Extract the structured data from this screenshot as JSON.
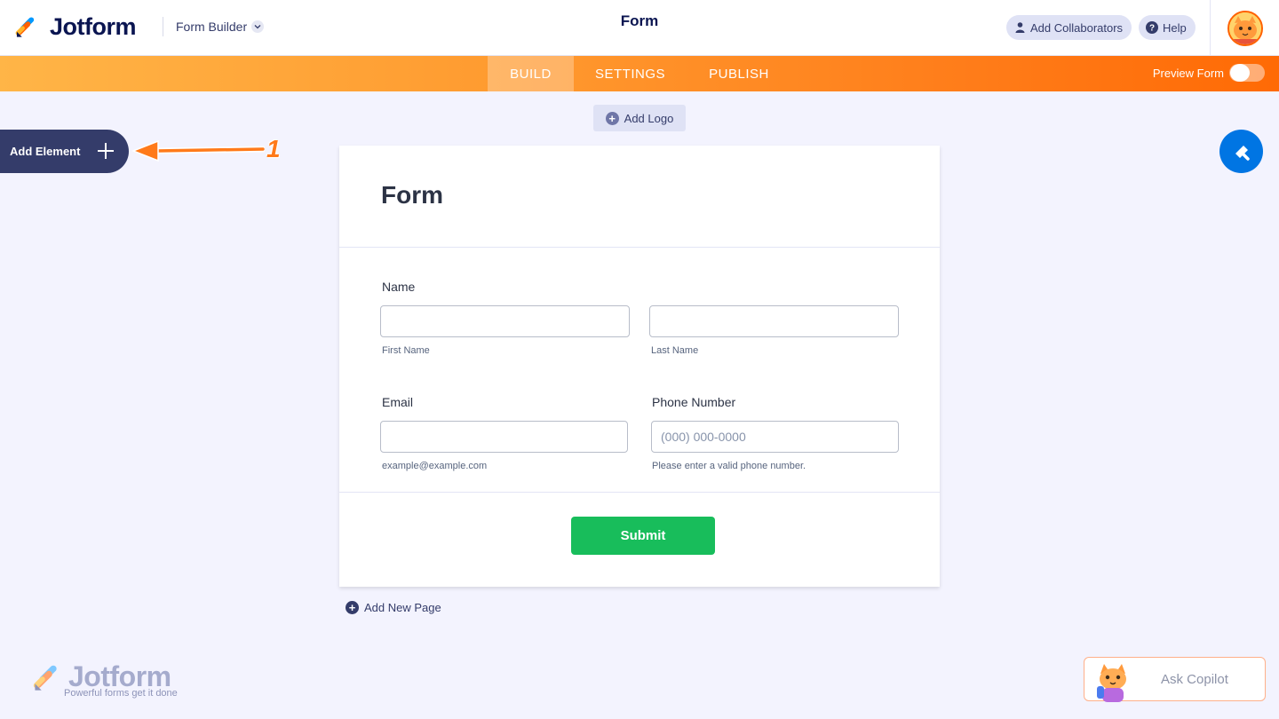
{
  "app": {
    "name": "Jotform",
    "menu_label": "Form Builder",
    "doc_title": "Form"
  },
  "header": {
    "collaborators": "Add Collaborators",
    "help": "Help"
  },
  "nav": {
    "tabs": [
      {
        "label": "BUILD",
        "active": true
      },
      {
        "label": "SETTINGS"
      },
      {
        "label": "PUBLISH"
      }
    ],
    "preview_label": "Preview Form",
    "preview_on": false
  },
  "canvas": {
    "add_logo": "Add Logo",
    "add_element": "Add Element",
    "callout_number": "1",
    "add_new_page": "Add New Page"
  },
  "form": {
    "title": "Form",
    "name_label": "Name",
    "first_name_sub": "First Name",
    "last_name_sub": "Last Name",
    "email_label": "Email",
    "email_sub": "example@example.com",
    "phone_label": "Phone Number",
    "phone_placeholder": "(000) 000-0000",
    "phone_sub": "Please enter a valid phone number.",
    "submit": "Submit"
  },
  "footer": {
    "logo_text": "Jotform",
    "tagline": "Powerful forms get it done",
    "copilot": "Ask Copilot"
  },
  "colors": {
    "orange": "#ff7d1a",
    "navy": "#0a1551",
    "green": "#18bd5b",
    "blue": "#0075e3",
    "panel": "#343c6a"
  }
}
